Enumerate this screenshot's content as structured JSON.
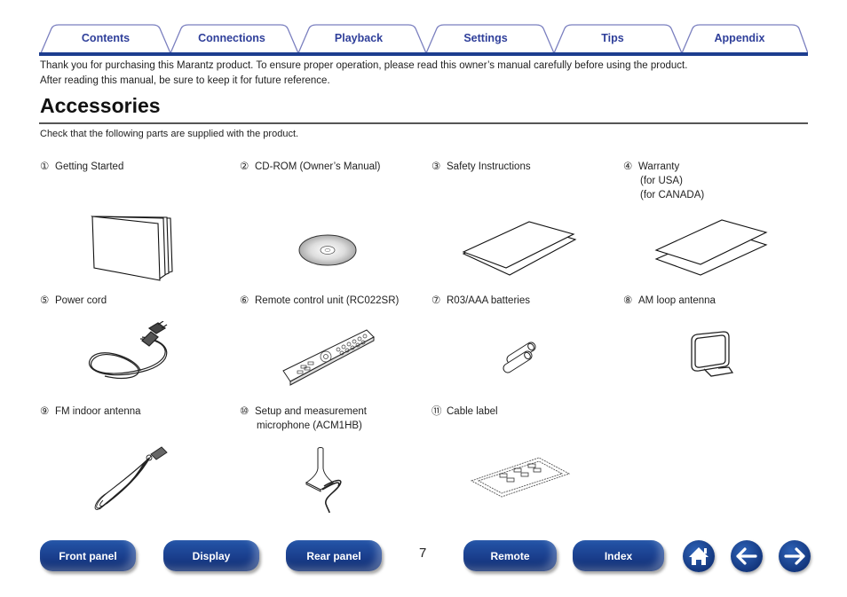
{
  "tabs": [
    {
      "label": "Contents"
    },
    {
      "label": "Connections"
    },
    {
      "label": "Playback"
    },
    {
      "label": "Settings"
    },
    {
      "label": "Tips"
    },
    {
      "label": "Appendix"
    }
  ],
  "intro": {
    "line1": "Thank you for purchasing this Marantz product. To ensure proper operation, please read this owner’s manual carefully before using the product.",
    "line2": "After reading this manual, be sure to keep it for future reference."
  },
  "section": {
    "title": "Accessories",
    "subtext": "Check that the following parts are supplied with the product."
  },
  "accessories": [
    {
      "num": "①",
      "name": "Getting Started",
      "icon": "booklet-icon"
    },
    {
      "num": "②",
      "name": "CD-ROM (Owner’s Manual)",
      "icon": "cd-rom-icon"
    },
    {
      "num": "③",
      "name": "Safety Instructions",
      "icon": "safety-sheets-icon"
    },
    {
      "num": "④",
      "name": "Warranty",
      "sub": [
        "(for USA)",
        "(for CANADA)"
      ],
      "icon": "warranty-sheets-icon"
    },
    {
      "num": "⑤",
      "name": "Power cord",
      "icon": "power-cord-icon"
    },
    {
      "num": "⑥",
      "name": "Remote control unit (RC022SR)",
      "icon": "remote-control-icon"
    },
    {
      "num": "⑦",
      "name": "R03/AAA batteries",
      "icon": "batteries-icon"
    },
    {
      "num": "⑧",
      "name": "AM loop antenna",
      "icon": "am-loop-antenna-icon"
    },
    {
      "num": "⑨",
      "name": "FM indoor antenna",
      "icon": "fm-antenna-icon"
    },
    {
      "num": "⑩",
      "name": "Setup and measurement",
      "name2": "microphone (ACM1HB)",
      "icon": "microphone-icon"
    },
    {
      "num": "⑪",
      "name": "Cable label",
      "icon": "cable-label-icon"
    }
  ],
  "footer": {
    "buttons": [
      "Front panel",
      "Display",
      "Rear panel",
      "Remote",
      "Index"
    ],
    "page_number": "7",
    "nav_icons": [
      "home-icon",
      "arrow-left-icon",
      "arrow-right-icon"
    ]
  },
  "colors": {
    "brand_blue": "#1c3d8f",
    "tab_text": "#2f3f9a",
    "tab_outline": "#7a7fbf"
  }
}
